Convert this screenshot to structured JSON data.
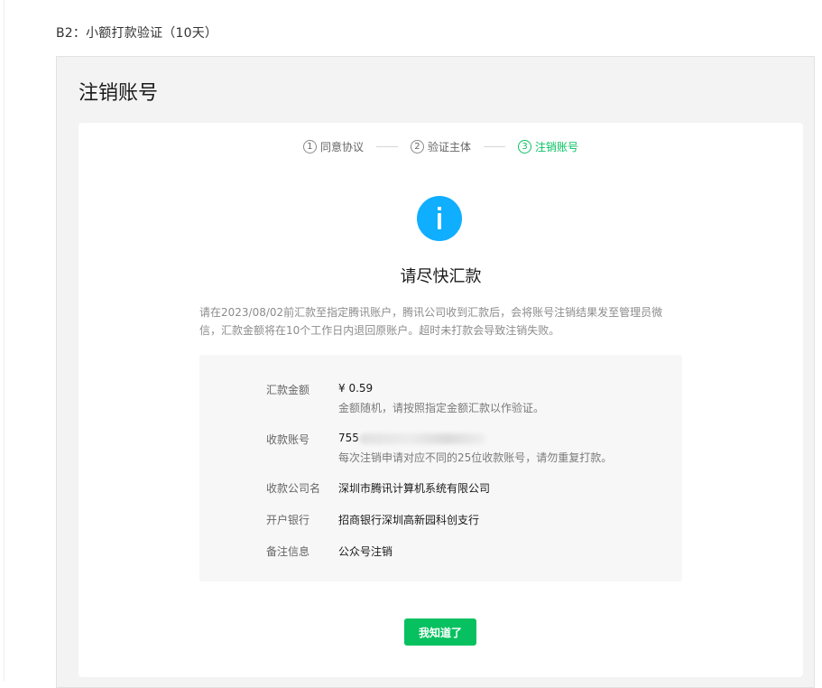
{
  "section_title": "B2：小额打款验证（10天）",
  "panel_title": "注销账号",
  "steps": [
    {
      "num": "1",
      "label": "同意协议",
      "active": false
    },
    {
      "num": "2",
      "label": "验证主体",
      "active": false
    },
    {
      "num": "3",
      "label": "注销账号",
      "active": true
    }
  ],
  "headline": "请尽快汇款",
  "description": "请在2023/08/02前汇款至指定腾讯账户，腾讯公司收到汇款后，会将账号注销结果发至管理员微信，汇款金额将在10个工作日内退回原账户。超时未打款会导致注销失败。",
  "details": {
    "amount_label": "汇款金额",
    "amount_value": "¥ 0.59",
    "amount_hint": "金额随机，请按照指定金额汇款以作验证。",
    "account_label": "收款账号",
    "account_value_visible": "755",
    "account_hint": "每次注销申请对应不同的25位收款账号，请勿重复打款。",
    "company_label": "收款公司名",
    "company_value": "深圳市腾讯计算机系统有限公司",
    "bank_label": "开户银行",
    "bank_value": "招商银行深圳高新园科创支行",
    "note_label": "备注信息",
    "note_value": "公众号注销"
  },
  "ok_button_label": "我知道了",
  "colors": {
    "accent_green": "#07c160",
    "info_blue": "#10aeff"
  },
  "icons": {
    "info": "info-icon"
  }
}
